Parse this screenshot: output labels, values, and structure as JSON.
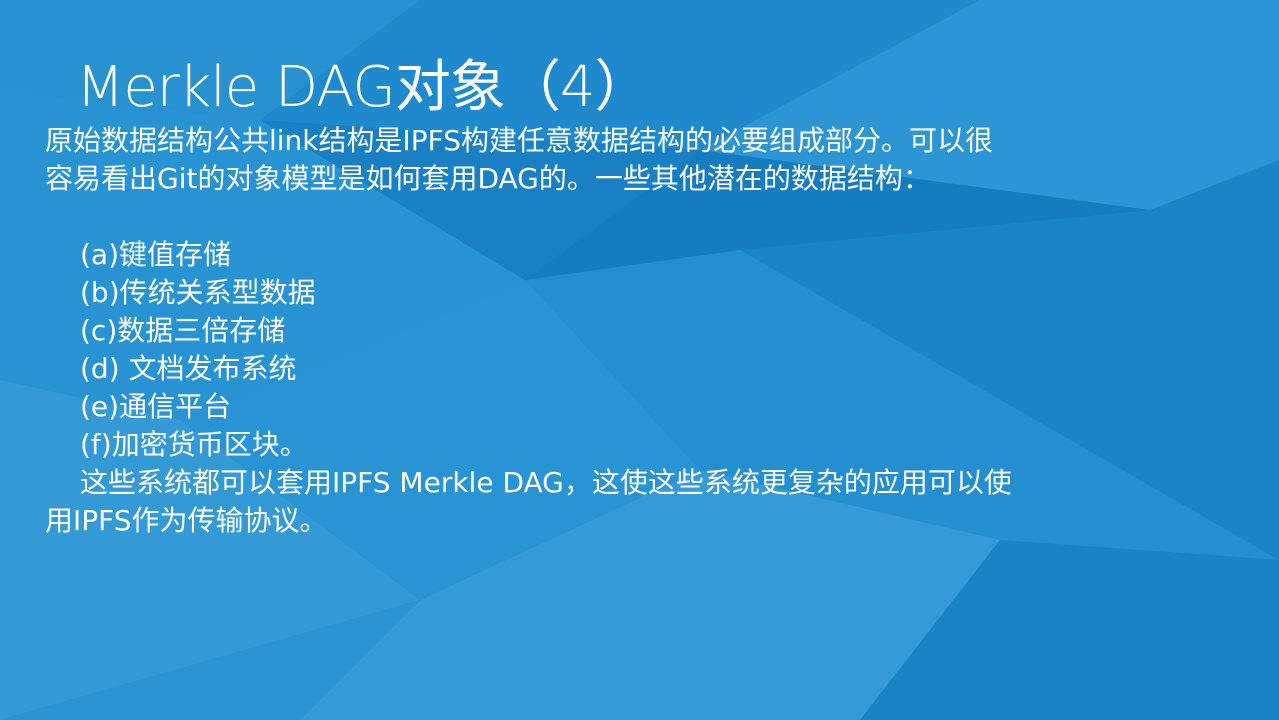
{
  "colors": {
    "background": "#1a86c9",
    "text": "#ffffff"
  },
  "slide": {
    "title": "Merkle DAG对象（4）",
    "paragraph1_line1": "原始数据结构公共link结构是IPFS构建任意数据结构的必要组成部分。可以很",
    "paragraph1_line2": "容易看出Git的对象模型是如何套用DAG的。一些其他潜在的数据结构：",
    "items": [
      "(a)键值存储",
      "(b)传统关系型数据",
      "(c)数据三倍存储",
      "(d) 文档发布系统",
      "(e)通信平台",
      "(f)加密货币区块。"
    ],
    "paragraph2_line1": "这些系统都可以套用IPFS Merkle DAG，这使这些系统更复杂的应用可以使",
    "paragraph2_line2": "用IPFS作为传输协议。"
  }
}
